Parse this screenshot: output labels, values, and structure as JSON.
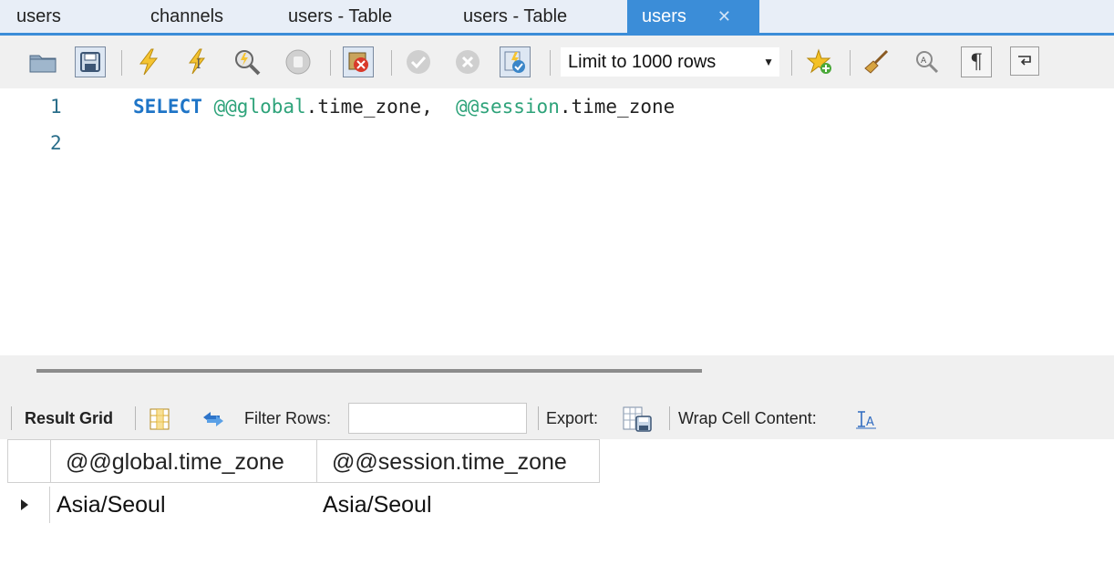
{
  "tabs": [
    {
      "label": "users"
    },
    {
      "label": "channels"
    },
    {
      "label": "users - Table"
    },
    {
      "label": "users - Table"
    },
    {
      "label": "users",
      "active": true,
      "close": "✕"
    }
  ],
  "toolbar": {
    "limit_select": "Limit to 1000 rows",
    "icons": [
      "open-folder-icon",
      "save-icon",
      "execute-icon",
      "execute-current-icon",
      "explain-icon",
      "stop-icon",
      "toggle-error-icon",
      "commit-icon",
      "rollback-icon",
      "autocommit-icon",
      "add-snippet-icon",
      "beautify-icon",
      "find-icon",
      "invisible-chars-icon",
      "wrap-icon"
    ]
  },
  "editor": {
    "lines": [
      {
        "number": "1",
        "keyword": "SELECT",
        "var1": "@@global",
        "text1": ".time_zone,",
        "var2": "@@session",
        "text2": ".time_zone"
      },
      {
        "number": "2"
      }
    ]
  },
  "result_toolbar": {
    "result_grid": "Result Grid",
    "filter_rows": "Filter Rows:",
    "filter_value": "",
    "export": "Export:",
    "wrap_cell": "Wrap Cell Content:"
  },
  "result_grid": {
    "columns": [
      "@@global.time_zone",
      "@@session.time_zone"
    ],
    "rows": [
      [
        "Asia/Seoul",
        "Asia/Seoul"
      ]
    ]
  },
  "colors": {
    "accent": "#3b8dd8",
    "keyword": "#1f75c7",
    "variable": "#2ea37a"
  }
}
